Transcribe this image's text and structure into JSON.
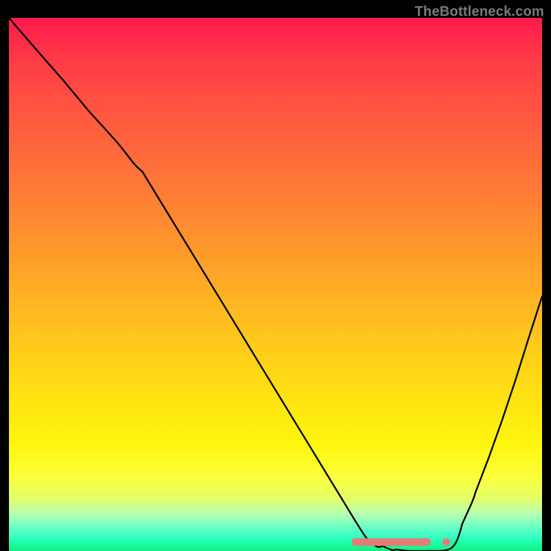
{
  "watermark": "TheBottleneck.com",
  "chart_data": {
    "type": "line",
    "title": "",
    "xlabel": "",
    "ylabel": "",
    "xlim": [
      0,
      1
    ],
    "ylim": [
      0,
      1
    ],
    "x": [
      0.0,
      0.05,
      0.1,
      0.15,
      0.2,
      0.25,
      0.3,
      0.35,
      0.4,
      0.45,
      0.5,
      0.55,
      0.6,
      0.65,
      0.675,
      0.7,
      0.725,
      0.75,
      0.775,
      0.8,
      0.825,
      0.85,
      0.875,
      0.9,
      0.925,
      0.95,
      0.975,
      1.0
    ],
    "values": [
      1.0,
      0.942,
      0.885,
      0.825,
      0.77,
      0.712,
      0.63,
      0.548,
      0.466,
      0.384,
      0.302,
      0.22,
      0.138,
      0.056,
      0.028,
      0.01,
      0.003,
      0.0,
      0.0,
      0.0,
      0.0,
      0.01,
      0.05,
      0.11,
      0.175,
      0.245,
      0.32,
      0.4
    ],
    "annotations": [
      {
        "kind": "marker-bar",
        "x_start": 0.65,
        "x_end": 0.785,
        "y": 0.016
      },
      {
        "kind": "marker-dot",
        "x": 0.82,
        "y": 0.016
      }
    ],
    "background": "vertical-gradient red→orange→yellow→green",
    "axes_visible": false,
    "ticks_visible": false
  }
}
